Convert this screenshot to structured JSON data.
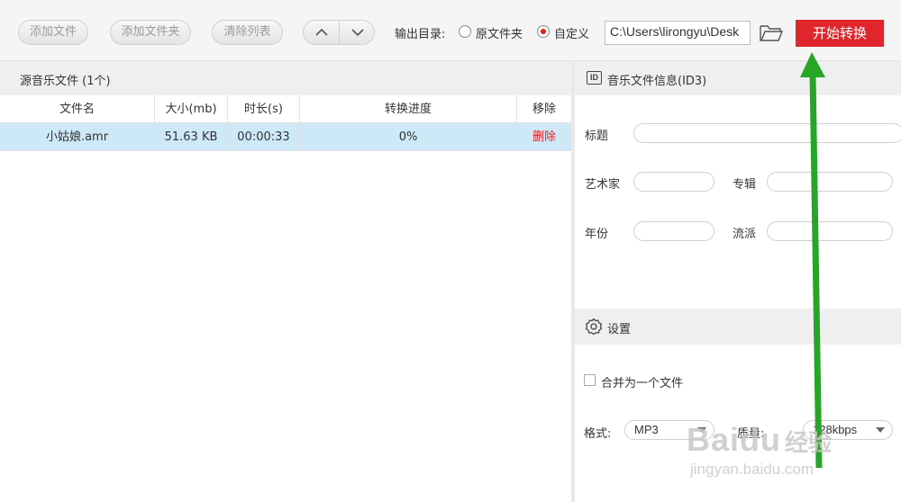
{
  "toolbar": {
    "add_file": "添加文件",
    "add_folder": "添加文件夹",
    "clear_list": "清除列表",
    "output_dir_label": "输出目录:",
    "radio_original": "原文件夹",
    "radio_custom": "自定义",
    "selected_radio": "自定义",
    "path_value": "C:\\Users\\lirongyu\\Desk",
    "start_button": "开始转换"
  },
  "file_list": {
    "title": "源音乐文件 (1个)",
    "columns": [
      "文件名",
      "大小(mb)",
      "时长(s)",
      "转换进度",
      "移除"
    ],
    "rows": [
      [
        "小姑娘.amr",
        "51.63 KB",
        "00:00:33",
        "0%",
        "删除"
      ]
    ]
  },
  "id3": {
    "badge": "ID",
    "title": "音乐文件信息(ID3)",
    "label_title": "标题",
    "label_artist": "艺术家",
    "label_album": "专辑",
    "label_year": "年份",
    "label_genre": "流派"
  },
  "settings": {
    "title": "设置",
    "merge_label": "合并为一个文件",
    "format_label": "格式:",
    "format_value": "MP3",
    "quality_label": "质量:",
    "quality_value": "128kbps"
  },
  "watermark": {
    "brand": "Baidu",
    "brand_cn": "经验",
    "url": "jingyan.baidu.com"
  },
  "colors": {
    "accent_red": "#e0262c",
    "selected_row": "#cde8f7",
    "annotation_arrow": "#27a527"
  }
}
